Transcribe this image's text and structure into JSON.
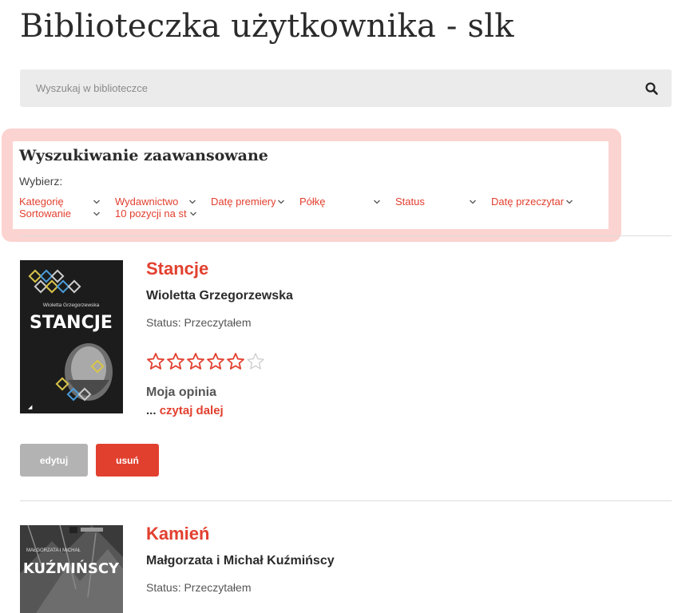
{
  "page": {
    "title": "Biblioteczka użytkownika - slk"
  },
  "search": {
    "placeholder": "Wyszukaj w biblioteczce",
    "button_icon": "search-icon"
  },
  "advanced": {
    "title": "Wyszukiwanie zaawansowane",
    "choose_label": "Wybierz:",
    "filters": [
      {
        "label": "Kategorię"
      },
      {
        "label": "Wydawnictwo"
      },
      {
        "label": "Datę premiery"
      },
      {
        "label": "Półkę"
      },
      {
        "label": "Status"
      },
      {
        "label": "Datę przeczytar"
      },
      {
        "label": "Sortowanie"
      },
      {
        "label": "10 pozycji na st"
      }
    ]
  },
  "books": [
    {
      "title": "Stancje",
      "author": "Wioletta Grzegorzewska",
      "status": "Status: Przeczytałem",
      "rating": 5,
      "rating_max": 6,
      "opinion_label": "Moja opinia",
      "read_more_prefix": "...",
      "read_more": "czytaj dalej",
      "edit_label": "edytuj",
      "delete_label": "usuń",
      "cover": {
        "author_text": "Wioletta Grzegorzewska",
        "title_text": "STANCJE"
      }
    },
    {
      "title": "Kamień",
      "author": "Małgorzata i Michał Kuźmińscy",
      "status": "Status: Przeczytałem",
      "cover": {
        "author_text": "MAŁGORZATA I MICHAŁ",
        "title_text": "KUŹMIŃSCY"
      }
    }
  ],
  "colors": {
    "accent": "#e2402f",
    "panel_border": "#fbd3d0",
    "search_bg": "#ebebeb",
    "edit_bg": "#b3b3b3"
  }
}
